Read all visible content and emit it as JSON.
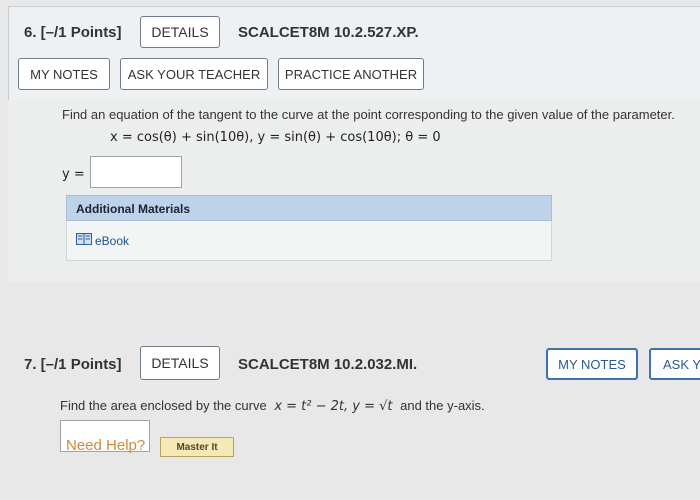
{
  "q6": {
    "title": "6.  [–/1 Points]",
    "details": "DETAILS",
    "code": "SCALCET8M 10.2.527.XP.",
    "my_notes": "MY NOTES",
    "ask_teacher": "ASK YOUR TEACHER",
    "practice": "PRACTICE ANOTHER",
    "prompt": "Find an equation of the tangent to the curve at the point corresponding to the given value of the parameter.",
    "equation": "x = cos(θ) + sin(10θ),   y = sin(θ) + cos(10θ);   θ = 0",
    "answer_label": "y =",
    "answer_value": "",
    "additional_materials": "Additional Materials",
    "ebook": "eBook"
  },
  "q7": {
    "title": "7.  [–/1 Points]",
    "details": "DETAILS",
    "code": "SCALCET8M 10.2.032.MI.",
    "my_notes": "MY NOTES",
    "ask": "ASK Y",
    "prompt_pre": "Find the area enclosed by the curve",
    "prompt_math": "x = t² − 2t, y = √t",
    "prompt_post": "and the y-axis.",
    "answer_value": "",
    "need_help": "Need Help?",
    "master_it": "Master It"
  },
  "colors": {
    "accent_blue": "#3d74b0",
    "help_orange": "#cf8a3a",
    "panel_blue": "#bcd3ea"
  },
  "icons": {
    "ebook": "book-icon"
  }
}
